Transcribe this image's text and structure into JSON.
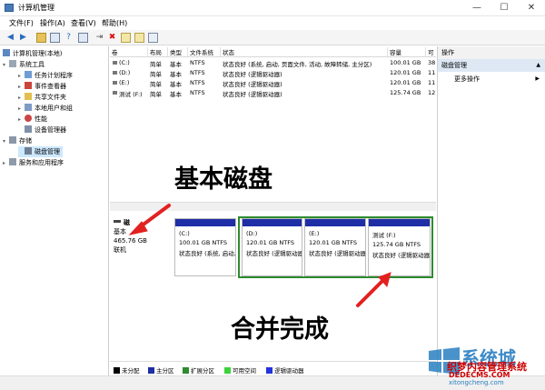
{
  "window": {
    "title": "计算机管理",
    "controls": [
      "—",
      "☐",
      "✕"
    ]
  },
  "menu": [
    "文件(F)",
    "操作(A)",
    "查看(V)",
    "帮助(H)"
  ],
  "toolbar_icons": [
    "back-arrow-icon",
    "forward-arrow-icon",
    "up-folder-icon",
    "show-hide-tree-icon",
    "properties-icon",
    "help-icon",
    "connect-icon",
    "delete-icon",
    "new-icon",
    "refresh-icon",
    "export-icon"
  ],
  "tree": {
    "root": "计算机管理(本地)",
    "system_tools": "系统工具",
    "task_scheduler": "任务计划程序",
    "event_viewer": "事件查看器",
    "shared_folders": "共享文件夹",
    "local_users": "本地用户和组",
    "performance": "性能",
    "device_manager": "设备管理器",
    "storage": "存储",
    "disk_management": "磁盘管理",
    "services": "服务和应用程序"
  },
  "volume_list": {
    "headers": [
      "卷",
      "布局",
      "类型",
      "文件系统",
      "状态",
      "容量",
      "可"
    ],
    "rows": [
      [
        "(C:)",
        "简单",
        "基本",
        "NTFS",
        "状态良好 (系统, 启动, 页面文件, 活动, 故障转储, 主分区)",
        "100.01 GB",
        "38"
      ],
      [
        "(D:)",
        "简单",
        "基本",
        "NTFS",
        "状态良好 (逻辑驱动器)",
        "120.01 GB",
        "11"
      ],
      [
        "(E:)",
        "简单",
        "基本",
        "NTFS",
        "状态良好 (逻辑驱动器)",
        "120.01 GB",
        "11"
      ],
      [
        "测试 (F:)",
        "简单",
        "基本",
        "NTFS",
        "状态良好 (逻辑驱动器)",
        "125.74 GB",
        "12"
      ]
    ]
  },
  "disk": {
    "name": "磁",
    "type": "基本",
    "size": "465.76 GB",
    "status": "联机",
    "partitions": [
      {
        "label": "(C:)",
        "size": "100.01 GB NTFS",
        "status": "状态良好 (系统, 启动, 页面"
      },
      {
        "label": "(D:)",
        "size": "120.01 GB NTFS",
        "status": "状态良好 (逻辑驱动器)"
      },
      {
        "label": "(E:)",
        "size": "120.01 GB NTFS",
        "status": "状态良好 (逻辑驱动器)"
      },
      {
        "label": "测试 (F:)",
        "size": "125.74 GB NTFS",
        "status": "状态良好 (逻辑驱动器"
      }
    ]
  },
  "legend": [
    {
      "label": "未分配",
      "color": "#000000"
    },
    {
      "label": "主分区",
      "color": "#1d2ea6"
    },
    {
      "label": "扩展分区",
      "color": "#2e8b2e"
    },
    {
      "label": "可用空间",
      "color": "#3cd23c"
    },
    {
      "label": "逻辑驱动器",
      "color": "#2233dd"
    }
  ],
  "actions": {
    "title": "操作",
    "section": "磁盘管理",
    "more": "更多操作"
  },
  "annotations": {
    "basic_disk": "基本磁盘",
    "merge_done": "合并完成"
  },
  "watermark": {
    "brand": "系统城",
    "sub": "织梦内容管理系统",
    "dede": "DEDECMS.COM",
    "url": "xitongcheng.com"
  },
  "colors": {
    "annotation_arrow": "#e32020",
    "primary_bar": "#1d2ea6",
    "extended_border": "#2e8b2e"
  }
}
